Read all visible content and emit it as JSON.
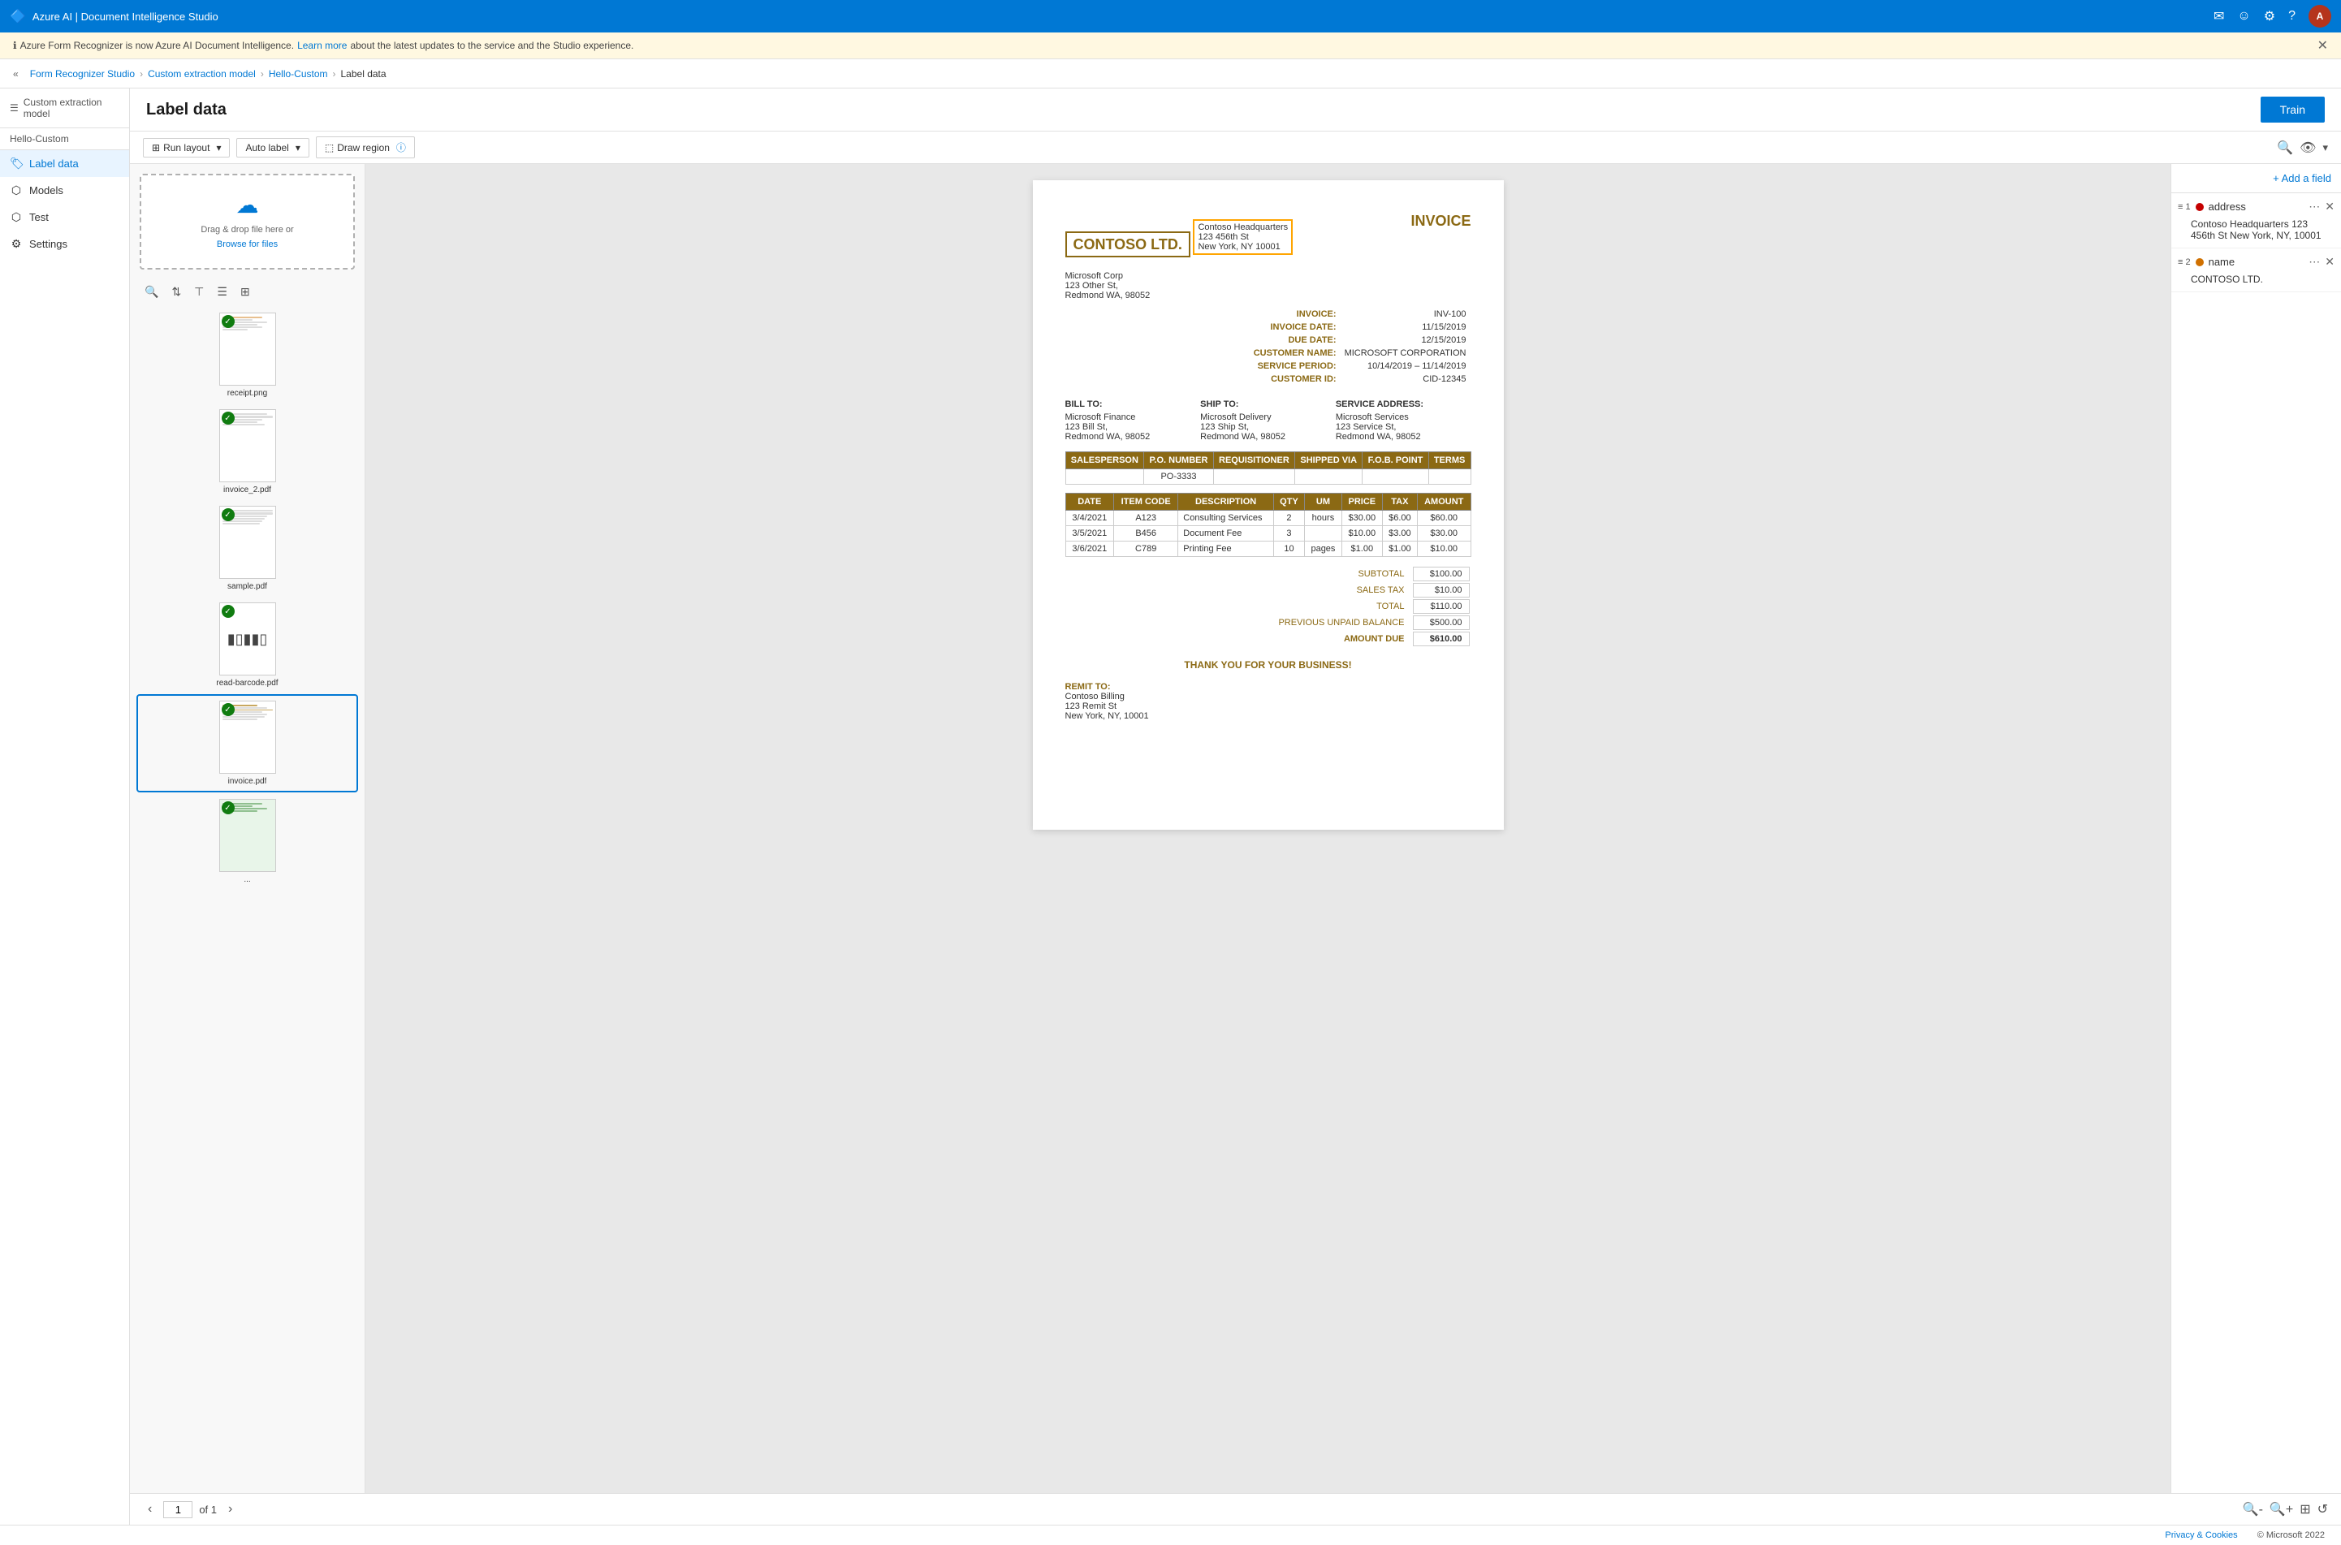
{
  "app": {
    "title": "Azure AI | Document Intelligence Studio",
    "top_bar": {
      "title": "Azure AI | Document Intelligence Studio"
    }
  },
  "info_bar": {
    "text": "Azure Form Recognizer is now Azure AI Document Intelligence.",
    "link_text": "Learn more",
    "after_link": "about the latest updates to the service and the Studio experience."
  },
  "nav": {
    "collapse_label": "«",
    "breadcrumbs": [
      {
        "label": "Form Recognizer Studio",
        "link": true
      },
      {
        "label": "Custom extraction model",
        "link": true
      },
      {
        "label": "Hello-Custom",
        "link": true
      },
      {
        "label": "Label data",
        "link": false
      }
    ]
  },
  "page": {
    "title": "Label data",
    "train_button": "Train"
  },
  "sidebar": {
    "model_label": "Custom extraction model",
    "sub_label": "Hello-Custom",
    "items": [
      {
        "id": "label-data",
        "label": "Label data",
        "icon": "🏷",
        "active": true
      },
      {
        "id": "models",
        "label": "Models",
        "icon": "⬡",
        "active": false
      },
      {
        "id": "test",
        "label": "Test",
        "icon": "⬡",
        "active": false
      },
      {
        "id": "settings",
        "label": "Settings",
        "icon": "⚙",
        "active": false
      }
    ]
  },
  "toolbar": {
    "run_layout": "Run layout",
    "auto_label": "Auto label",
    "draw_region": "Draw region"
  },
  "file_panel": {
    "upload_text": "Drag & drop file here or",
    "upload_link": "Browse for files",
    "files": [
      {
        "id": "receipt",
        "name": "receipt.png",
        "checked": true
      },
      {
        "id": "invoice2",
        "name": "invoice_2.pdf",
        "checked": true
      },
      {
        "id": "sample",
        "name": "sample.pdf",
        "checked": true
      },
      {
        "id": "barcode",
        "name": "read-barcode.pdf",
        "checked": true
      },
      {
        "id": "invoice",
        "name": "invoice.pdf",
        "checked": true,
        "active": true
      },
      {
        "id": "green",
        "name": "...",
        "checked": true
      }
    ]
  },
  "invoice": {
    "company": "CONTOSO LTD.",
    "title": "INVOICE",
    "address": {
      "line1": "Contoso Headquarters",
      "line2": "123 456th St",
      "line3": "New York, NY 10001"
    },
    "meta": {
      "invoice_no_label": "INVOICE:",
      "invoice_no": "INV-100",
      "invoice_date_label": "INVOICE DATE:",
      "invoice_date": "11/15/2019",
      "due_date_label": "DUE DATE:",
      "due_date": "12/15/2019",
      "customer_name_label": "CUSTOMER NAME:",
      "customer_name": "MICROSOFT CORPORATION",
      "service_period_label": "SERVICE PERIOD:",
      "service_period": "10/14/2019 – 11/14/2019",
      "customer_id_label": "CUSTOMER ID:",
      "customer_id": "CID-12345"
    },
    "bill_from": {
      "name": "Microsoft Corp",
      "address": "123 Other St,",
      "city": "Redmond WA, 98052"
    },
    "bill_to": {
      "label": "BILL TO:",
      "name": "Microsoft Finance",
      "address": "123 Bill St,",
      "city": "Redmond WA, 98052"
    },
    "ship_to": {
      "label": "SHIP TO:",
      "name": "Microsoft Delivery",
      "address": "123 Ship St,",
      "city": "Redmond WA, 98052"
    },
    "service_address": {
      "label": "SERVICE ADDRESS:",
      "name": "Microsoft Services",
      "address": "123 Service St,",
      "city": "Redmond WA, 98052"
    },
    "po_table": {
      "headers": [
        "SALESPERSON",
        "P.O. NUMBER",
        "REQUISITIONER",
        "SHIPPED VIA",
        "F.O.B. POINT",
        "TERMS"
      ],
      "rows": [
        [
          "",
          "PO-3333",
          "",
          "",
          "",
          ""
        ]
      ]
    },
    "items_table": {
      "headers": [
        "DATE",
        "ITEM CODE",
        "DESCRIPTION",
        "QTY",
        "UM",
        "PRICE",
        "TAX",
        "AMOUNT"
      ],
      "rows": [
        [
          "3/4/2021",
          "A123",
          "Consulting Services",
          "2",
          "hours",
          "$30.00",
          "$6.00",
          "$60.00"
        ],
        [
          "3/5/2021",
          "B456",
          "Document Fee",
          "3",
          "",
          "$10.00",
          "$3.00",
          "$30.00"
        ],
        [
          "3/6/2021",
          "C789",
          "Printing Fee",
          "10",
          "pages",
          "$1.00",
          "$1.00",
          "$10.00"
        ]
      ]
    },
    "totals": {
      "subtotal_label": "SUBTOTAL",
      "subtotal": "$100.00",
      "sales_tax_label": "SALES TAX",
      "sales_tax": "$10.00",
      "total_label": "TOTAL",
      "total": "$110.00",
      "unpaid_label": "PREVIOUS UNPAID BALANCE",
      "unpaid": "$500.00",
      "amount_due_label": "AMOUNT DUE",
      "amount_due": "$610.00"
    },
    "thank_you": "THANK YOU FOR YOUR BUSINESS!",
    "remit": {
      "label": "REMIT TO:",
      "name": "Contoso Billing",
      "address": "123 Remit St",
      "city": "New York, NY, 10001"
    }
  },
  "pagination": {
    "prev_label": "‹",
    "next_label": "›",
    "current_page": "1",
    "of_label": "of 1"
  },
  "right_panel": {
    "add_field_label": "+ Add a field",
    "fields": [
      {
        "num": "1",
        "dot_color": "red",
        "name": "address",
        "value": "Contoso Headquarters 123 456th St New York, NY, 10001"
      },
      {
        "num": "2",
        "dot_color": "orange",
        "name": "name",
        "value": "CONTOSO LTD."
      }
    ]
  },
  "footer": {
    "privacy": "Privacy & Cookies",
    "copyright": "© Microsoft 2022"
  }
}
